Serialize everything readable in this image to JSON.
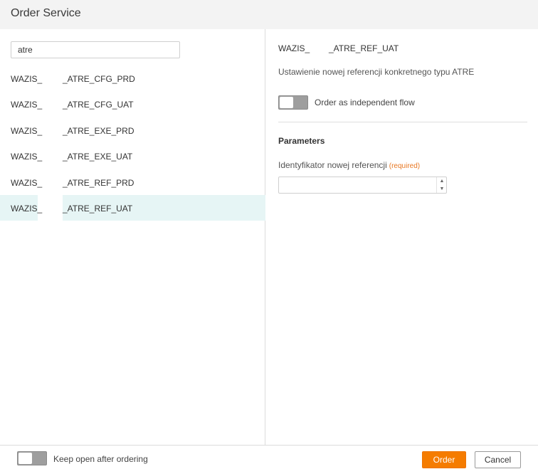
{
  "dialog": {
    "title": "Order Service"
  },
  "search": {
    "value": "atre",
    "placeholder": ""
  },
  "services": [
    {
      "prefix": "WAZIS_",
      "suffix": "_ATRE_CFG_PRD",
      "selected": false
    },
    {
      "prefix": "WAZIS_",
      "suffix": "_ATRE_CFG_UAT",
      "selected": false
    },
    {
      "prefix": "WAZIS_",
      "suffix": "_ATRE_EXE_PRD",
      "selected": false
    },
    {
      "prefix": "WAZIS_",
      "suffix": "_ATRE_EXE_UAT",
      "selected": false
    },
    {
      "prefix": "WAZIS_",
      "suffix": "_ATRE_REF_PRD",
      "selected": false
    },
    {
      "prefix": "WAZIS_",
      "suffix": "_ATRE_REF_UAT",
      "selected": true
    }
  ],
  "detail": {
    "name_prefix": "WAZIS_",
    "name_suffix": "_ATRE_REF_UAT",
    "description": "Ustawienie nowej referencji konkretnego typu ATRE",
    "flow_toggle_label": "Order as independent flow",
    "flow_toggle_on": false,
    "parameters_title": "Parameters",
    "field_label": "Identyfikator nowej referencji",
    "field_required": "(required)",
    "field_value": ""
  },
  "footer": {
    "keep_open_label": "Keep open after ordering",
    "keep_open_on": false,
    "order_label": "Order",
    "cancel_label": "Cancel"
  },
  "colors": {
    "accent": "#f57c00",
    "selection": "#e6f5f5",
    "required": "#e87722",
    "toggle_off": "#9e9e9e"
  }
}
